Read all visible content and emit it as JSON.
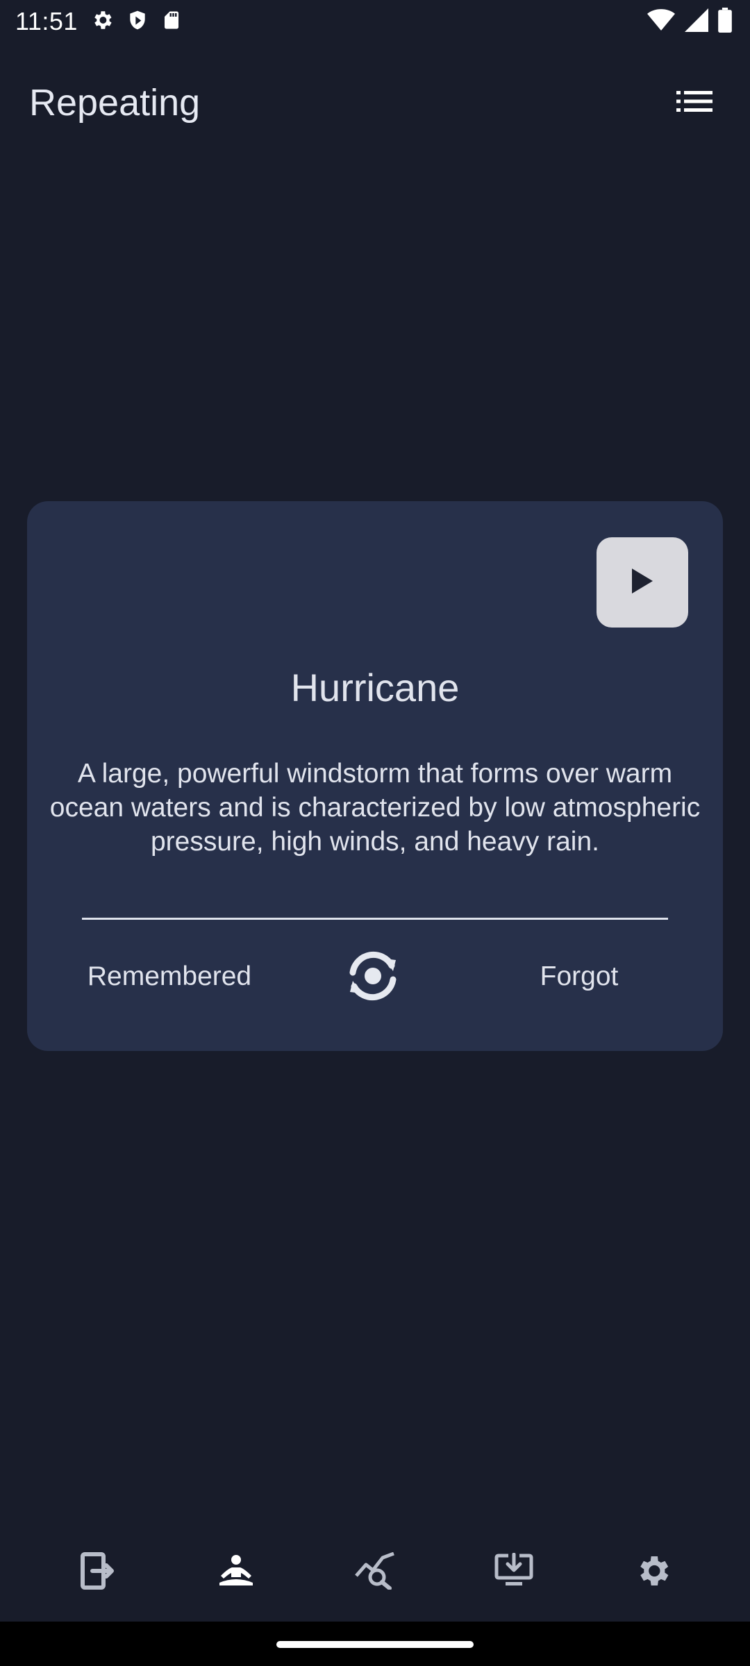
{
  "status_bar": {
    "time": "11:51",
    "left_icons": [
      "gear-icon",
      "shield-icon",
      "sd-card-icon"
    ],
    "right_icons": [
      "wifi-icon",
      "signal-icon",
      "battery-icon"
    ]
  },
  "app_bar": {
    "title": "Repeating",
    "action_icon": "list-icon"
  },
  "card": {
    "play_icon": "play-icon",
    "word": "Hurricane",
    "definition": "A large, powerful windstorm that forms over warm ocean waters and is characterized by low atmospheric pressure, high winds, and heavy rain.",
    "remembered_label": "Remembered",
    "flip_icon": "flip-card-icon",
    "forgot_label": "Forgot"
  },
  "bottom_nav": {
    "items": [
      {
        "icon": "exit-icon",
        "selected": false
      },
      {
        "icon": "meditation-icon",
        "selected": true
      },
      {
        "icon": "chart-search-icon",
        "selected": false
      },
      {
        "icon": "download-icon",
        "selected": false
      },
      {
        "icon": "settings-icon",
        "selected": false
      }
    ]
  },
  "colors": {
    "background": "#181c2a",
    "card": "#27304a",
    "text": "#e1e4ed",
    "play_button": "#d9d9de",
    "nav_icon": "#b8bdc9",
    "nav_icon_selected": "#ffffff"
  }
}
